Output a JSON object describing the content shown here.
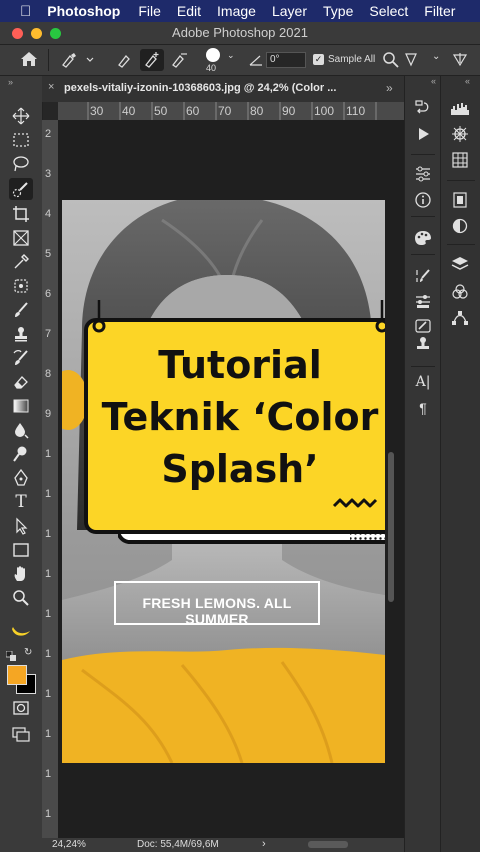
{
  "menubar": {
    "apple_icon": "apple-icon",
    "app_name": "Photoshop",
    "items": [
      "File",
      "Edit",
      "Image",
      "Layer",
      "Type",
      "Select",
      "Filter"
    ]
  },
  "window": {
    "title": "Adobe Photoshop 2021"
  },
  "options_bar": {
    "brush_size": "40",
    "angle_value": "0°",
    "sample_all_label": "Sample All",
    "sample_all_checked": true
  },
  "document_tab": {
    "label": "pexels-vitaliy-izonin-10368603.jpg @ 24,2% (Color ..."
  },
  "ruler": {
    "h_ticks": [
      "30",
      "40",
      "50",
      "60",
      "70",
      "80",
      "90",
      "100",
      "110"
    ],
    "v_ticks": [
      "2",
      "3",
      "4",
      "5",
      "6",
      "7",
      "8",
      "9",
      "1",
      "1",
      "1",
      "1",
      "1",
      "1",
      "1",
      "1",
      "1",
      "1"
    ]
  },
  "artwork": {
    "sign_line1": "Tutorial",
    "sign_line2": "Teknik ‘Color",
    "sign_line3": "Splash’",
    "banner_text": "FRESH LEMONS. ALL SUMMER",
    "colors": {
      "sign_yellow": "#fcd526",
      "shirt_yellow": "#f0b323",
      "outline": "#111111"
    }
  },
  "status_bar": {
    "zoom": "24,24%",
    "doc_info": "Doc: 55,4M/69,6M"
  },
  "colors": {
    "foreground": "#f5a623",
    "background": "#000000",
    "menubar": "#1e2a6a"
  }
}
